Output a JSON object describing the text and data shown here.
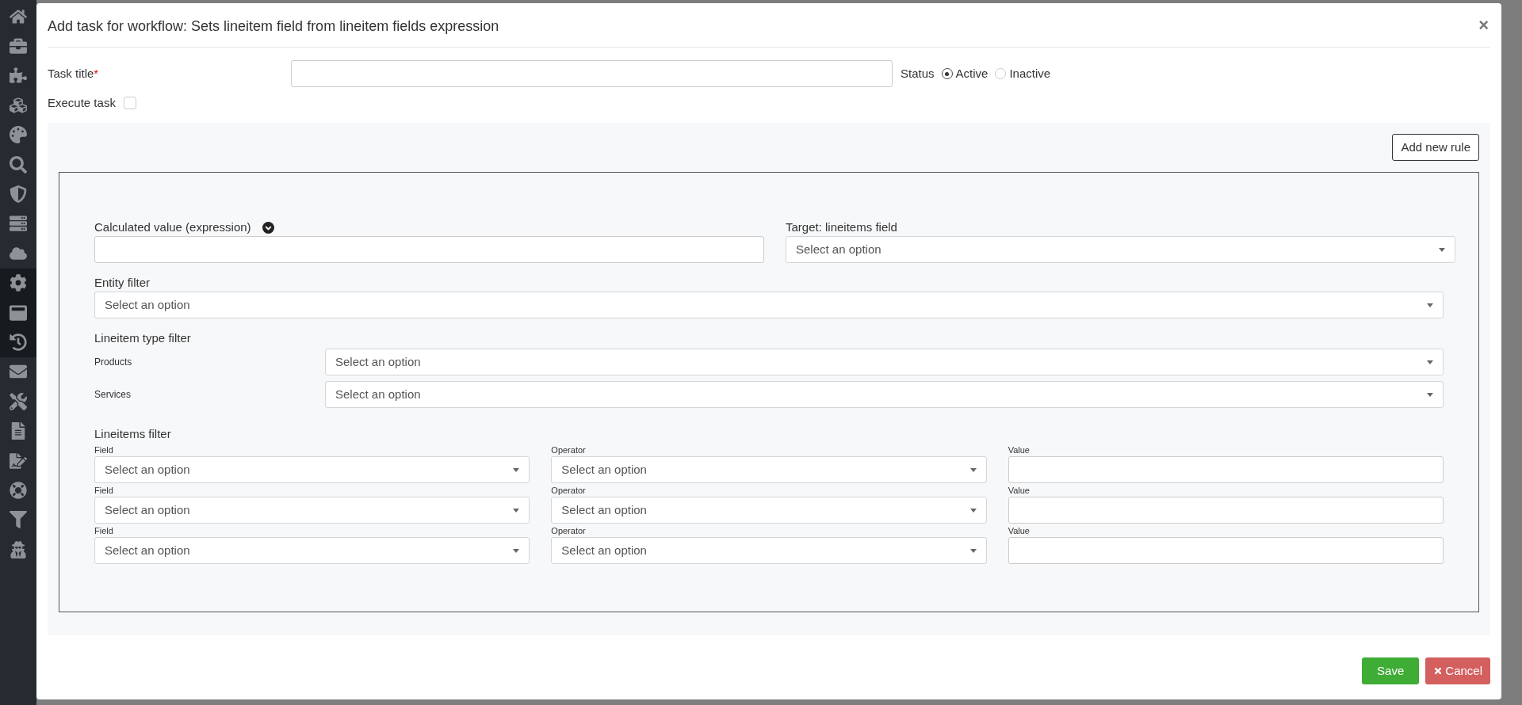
{
  "sidebar": {
    "items": [
      {
        "selected": false
      },
      {
        "selected": false
      },
      {
        "selected": false
      },
      {
        "selected": false
      },
      {
        "selected": false
      },
      {
        "selected": false
      },
      {
        "selected": false
      },
      {
        "selected": false
      },
      {
        "selected": false
      },
      {
        "selected": true
      },
      {
        "selected": true
      },
      {
        "selected": true
      },
      {
        "selected": false
      },
      {
        "selected": false
      },
      {
        "selected": false
      },
      {
        "selected": false
      },
      {
        "selected": false
      },
      {
        "selected": false
      },
      {
        "selected": false
      }
    ]
  },
  "dialog": {
    "title": "Add task for workflow: Sets lineitem field from lineitem fields expression",
    "close": "×",
    "task_title": {
      "label": "Task title",
      "required_mark": "*"
    },
    "status": {
      "label": "Status",
      "options": [
        {
          "label": "Active",
          "selected": true
        },
        {
          "label": "Inactive",
          "selected": false
        }
      ]
    },
    "execute_task": {
      "label": "Execute task",
      "checked": false
    },
    "add_rule_button": "Add new rule",
    "rule": {
      "calculated_value": {
        "label": "Calculated value (expression)"
      },
      "target": {
        "label": "Target: lineitems field",
        "placeholder": "Select an option"
      },
      "entity_filter": {
        "label": "Entity filter",
        "placeholder": "Select an option"
      },
      "lineitem_type_filter": {
        "label": "Lineitem type filter",
        "rows": [
          {
            "label": "Products",
            "placeholder": "Select an option"
          },
          {
            "label": "Services",
            "placeholder": "Select an option"
          }
        ]
      },
      "lineitems_filter": {
        "label": "Lineitems filter",
        "rows": [
          {
            "field": {
              "label": "Field",
              "placeholder": "Select an option"
            },
            "operator": {
              "label": "Operator",
              "placeholder": "Select an option"
            },
            "value": {
              "label": "Value"
            }
          },
          {
            "field": {
              "label": "Field",
              "placeholder": "Select an option"
            },
            "operator": {
              "label": "Operator",
              "placeholder": "Select an option"
            },
            "value": {
              "label": "Value"
            }
          },
          {
            "field": {
              "label": "Field",
              "placeholder": "Select an option"
            },
            "operator": {
              "label": "Operator",
              "placeholder": "Select an option"
            },
            "value": {
              "label": "Value"
            }
          }
        ]
      }
    },
    "buttons": {
      "save": "Save",
      "cancel": "Cancel"
    }
  }
}
